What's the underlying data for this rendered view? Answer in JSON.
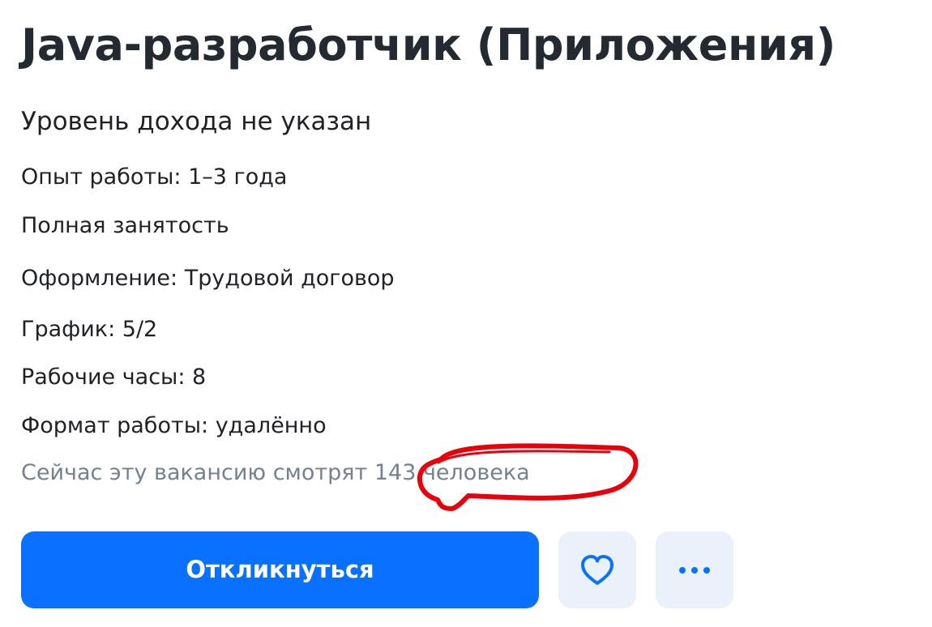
{
  "vacancy": {
    "title": "Java-разработчик (Приложения)",
    "salary": "Уровень дохода не указан",
    "details": [
      "Опыт работы: 1–3 года",
      "Полная занятость",
      "Оформление: Трудовой договор",
      "График: 5/2",
      "Рабочие часы: 8",
      "Формат работы: удалённо"
    ],
    "watchers": "Сейчас эту вакансию смотрят 143 человека"
  },
  "actions": {
    "apply_label": "Откликнуться",
    "favorite_icon": "heart-icon",
    "more_icon": "more-dots-icon"
  },
  "colors": {
    "title": "#232a31",
    "secondary_text": "#74818f",
    "accent": "#0a70ff",
    "icon_button_bg": "#eaf1fb",
    "annotation": "#e8000b"
  }
}
